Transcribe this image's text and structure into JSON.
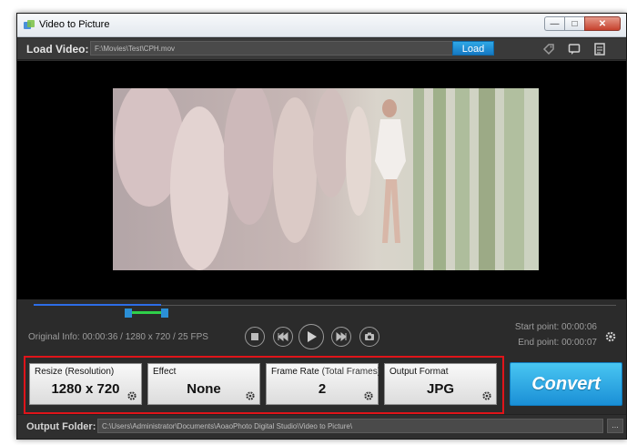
{
  "window": {
    "title": "Video to Picture"
  },
  "load": {
    "label": "Load Video:",
    "path": "F:\\Movies\\Test\\CPH.mov",
    "button": "Load"
  },
  "toolbar_icons": [
    "tag-icon",
    "comment-icon",
    "document-icon"
  ],
  "info": {
    "original": "Original Info: 00:00:36 / 1280 x 720 / 25 FPS",
    "start_point": "Start point: 00:00:06",
    "end_point": "End point: 00:00:07"
  },
  "options": [
    {
      "label": "Resize (Resolution)",
      "sublabel": "",
      "value": "1280 x 720"
    },
    {
      "label": "Effect",
      "sublabel": "",
      "value": "None"
    },
    {
      "label": "Frame Rate",
      "sublabel": "(Total Frames)",
      "value": "2"
    },
    {
      "label": "Output Format",
      "sublabel": "",
      "value": "JPG"
    }
  ],
  "convert": {
    "label": "Convert"
  },
  "output": {
    "label": "Output Folder:",
    "path": "C:\\Users\\Administrator\\Documents\\AoaoPhoto Digital Studio\\Video to Picture\\",
    "browse": "..."
  },
  "colors": {
    "accent": "#1a8fd6",
    "highlight_border": "#e0141a",
    "range": "#2fd04a",
    "timeline": "#2d6de6"
  }
}
